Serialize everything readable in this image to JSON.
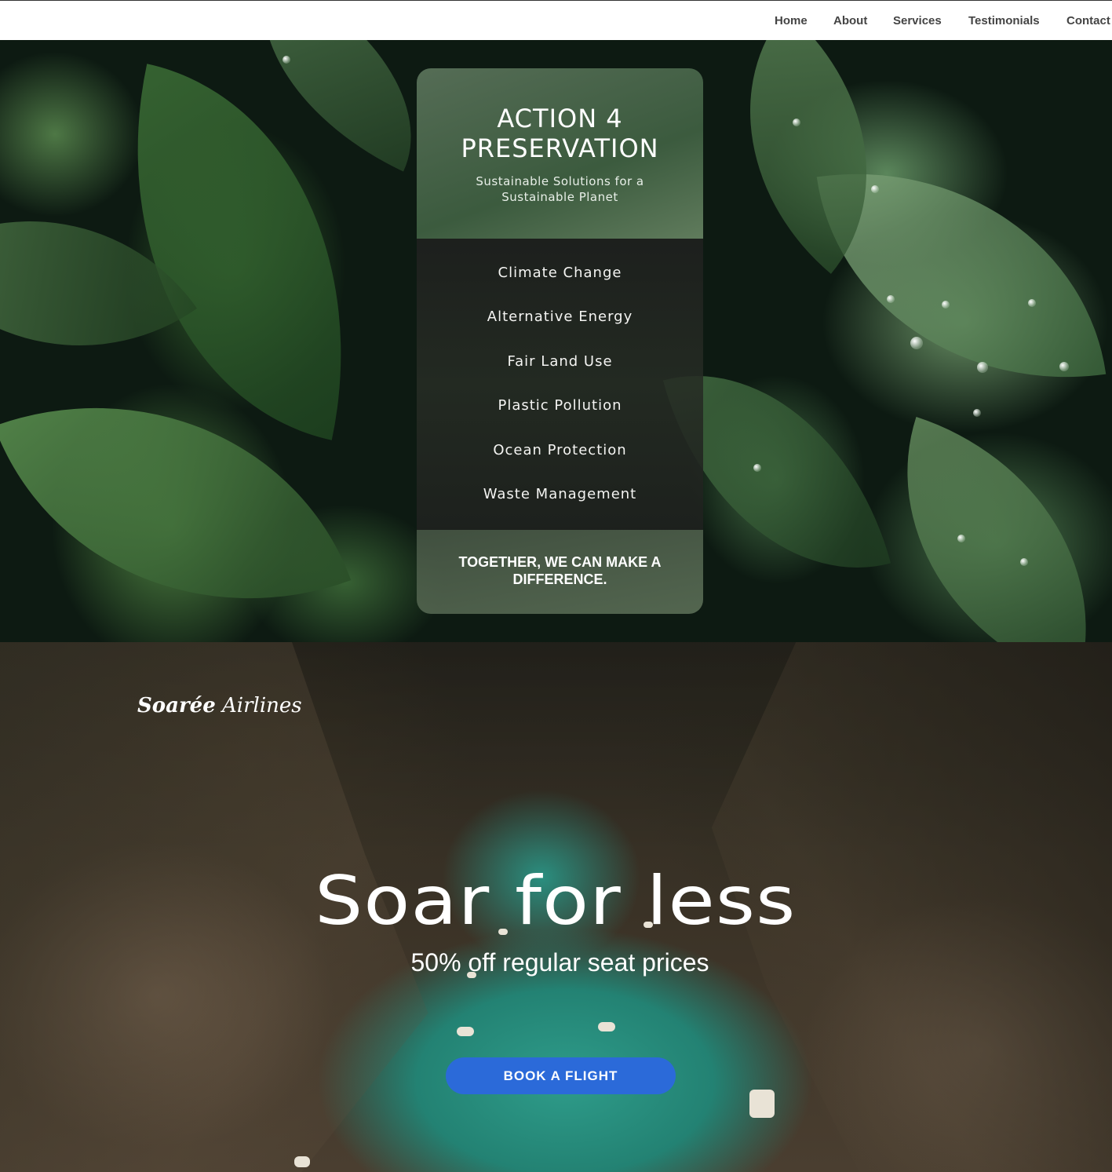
{
  "nav": {
    "items": [
      {
        "label": "Home"
      },
      {
        "label": "About"
      },
      {
        "label": "Services"
      },
      {
        "label": "Testimonials"
      },
      {
        "label": "Contact"
      }
    ]
  },
  "preservation_card": {
    "title": "ACTION 4 PRESERVATION",
    "subtitle": "Sustainable Solutions for a Sustainable Planet",
    "topics": [
      "Climate Change",
      "Alternative Energy",
      "Fair Land Use",
      "Plastic Pollution",
      "Ocean Protection",
      "Waste Management"
    ],
    "tagline": "TOGETHER, WE CAN MAKE A DIFFERENCE."
  },
  "airline": {
    "brand_bold": "Soarée",
    "brand_light": "Airlines",
    "hero_title": "Soar for less",
    "hero_subtitle": "50% off regular seat prices",
    "cta_label": "BOOK A FLIGHT",
    "cta_color": "#2b6ad9"
  },
  "colors": {
    "nav_background": "#ffffff",
    "nav_text": "#444444",
    "card_mid": "#1e201e",
    "water": "#2e9c8a"
  }
}
